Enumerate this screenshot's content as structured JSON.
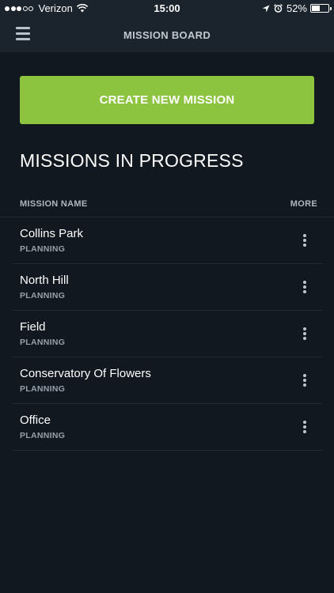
{
  "status_bar": {
    "carrier": "Verizon",
    "time": "15:00",
    "battery": "52%",
    "battery_level": 0.52
  },
  "nav": {
    "title": "MISSION BOARD"
  },
  "create_button_label": "CREATE NEW MISSION",
  "section_title": "MISSIONS IN PROGRESS",
  "list_header": {
    "name_col": "MISSION NAME",
    "more_col": "MORE"
  },
  "missions": [
    {
      "name": "Collins Park",
      "status": "PLANNING"
    },
    {
      "name": "North Hill",
      "status": "PLANNING"
    },
    {
      "name": "Field",
      "status": "PLANNING"
    },
    {
      "name": "Conservatory Of Flowers",
      "status": "PLANNING"
    },
    {
      "name": "Office",
      "status": "PLANNING"
    }
  ],
  "colors": {
    "background": "#121820",
    "bar": "#1b232d",
    "accent": "#8cc43f"
  }
}
